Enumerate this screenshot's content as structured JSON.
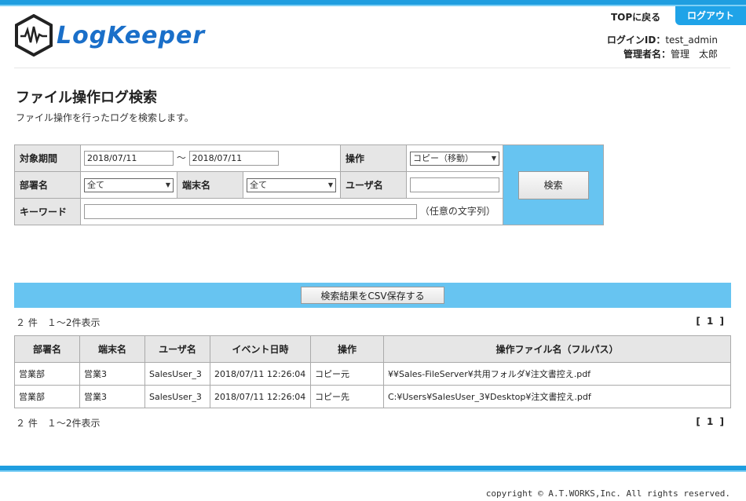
{
  "header": {
    "logo_text": "LogKeeper",
    "top_link": "TOPに戻る",
    "logout": "ログアウト",
    "login_id_label": "ログインID：",
    "login_id": "test_admin",
    "admin_name_label": "管理者名：",
    "admin_name": "管理　太郎"
  },
  "page": {
    "title": "ファイル操作ログ検索",
    "description": "ファイル操作を行ったログを検索します。"
  },
  "search": {
    "period_label": "対象期間",
    "date_from": "2018/07/11",
    "date_sep": "～",
    "date_to": "2018/07/11",
    "operation_label": "操作",
    "operation_value": "コピー（移動）",
    "department_label": "部署名",
    "department_value": "全て",
    "terminal_label": "端末名",
    "terminal_value": "全て",
    "user_label": "ユーザ名",
    "user_value": "",
    "keyword_label": "キーワード",
    "keyword_value": "",
    "keyword_hint": "（任意の文字列）",
    "search_button": "検索"
  },
  "results": {
    "csv_button": "検索結果をCSV保存する",
    "count_text": "２ 件　１～2件表示",
    "pager_text": "[ 1 ]",
    "columns": [
      "部署名",
      "端末名",
      "ユーザ名",
      "イベント日時",
      "操作",
      "操作ファイル名（フルパス）"
    ],
    "rows": [
      [
        "営業部",
        "営業3",
        "SalesUser_3",
        "2018/07/11 12:26:04",
        "コピー元",
        "¥¥Sales-FileServer¥共用フォルダ¥注文書控え.pdf"
      ],
      [
        "営業部",
        "営業3",
        "SalesUser_3",
        "2018/07/11 12:26:04",
        "コピー先",
        "C:¥Users¥SalesUser_3¥Desktop¥注文書控え.pdf"
      ]
    ]
  },
  "footer": {
    "copyright": "copyright © A.T.WORKS,Inc. All rights reserved."
  },
  "colors": {
    "accent": "#1f9ee0",
    "panel": "#67c4f1",
    "header_cell": "#e6e6e6"
  }
}
